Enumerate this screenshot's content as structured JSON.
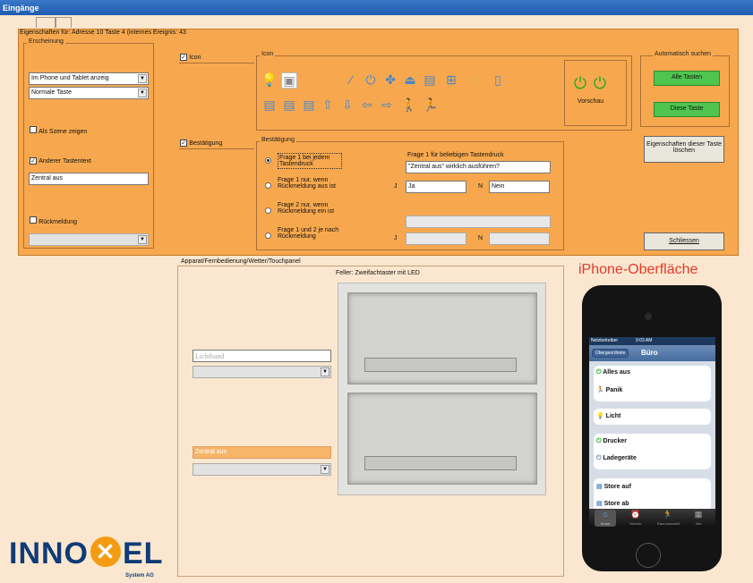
{
  "window": {
    "title": "Eingänge"
  },
  "tabs": [
    "",
    ""
  ],
  "header": {
    "caption": "Eigenschaften für: Adresse 10 Taste 4 (internes Ereignis: 43"
  },
  "erscheinung": {
    "label": "Erscheinung",
    "mode": "Im Phone und Tablet anzeig",
    "type": "Normale Taste",
    "scene_label": "Als Szene zeigen",
    "other_text_label": "Anderer Tastentext",
    "other_text_value": "Zentral aus",
    "feedback_label": "Rückmeldung",
    "feedback_value": ""
  },
  "icon_section": {
    "checkbox_label": "Icon",
    "group_label": "Icon",
    "preview_label": "Vorschau",
    "icons": [
      "bulb-icon",
      "dimmer-bulb-icon",
      "ceiling-light-icon",
      "stand-lamp-icon",
      "pencil-icon",
      "power-icon",
      "fan-icon",
      "ceiling-lamp-icon",
      "blind-icon",
      "window-icon",
      "lock-icon",
      "door-icon",
      "shutter-up-icon",
      "shutter-mid-icon",
      "shutter-down-icon",
      "arrow-up-icon",
      "arrow-down-icon",
      "arrow-left-icon",
      "arrow-right-icon",
      "walker-icon",
      "panic-icon"
    ]
  },
  "confirm": {
    "checkbox_label": "Bestätigung",
    "group_label": "Bestätigung",
    "option1": "Frage 1 bei jedem Tastendruck",
    "option2": "Frage 1 nur, wenn Rückmeldung aus ist",
    "option3": "Frage 2 nur, wenn Rückmeldung ein ist",
    "option4": "Frage 1 und 2 je nach Rückmeldung",
    "q1_title": "Frage 1 für beliebigen Tastendruck",
    "q1_text": "\"Zentral aus\" wirklich ausführen?",
    "j_label": "J",
    "j_value": "Ja",
    "n_label": "N",
    "n_value": "Nein",
    "q2_text": "",
    "j2_value": "",
    "n2_value": ""
  },
  "auto_search": {
    "label": "Automatisch suchen",
    "all_keys": "Alle Tasten",
    "this_key": "Diese Taste"
  },
  "clear_button": "Eigenschaften dieser Taste löschen",
  "close_button": "Schliessen",
  "device": {
    "group_label": "Apparat/Fernbedienung/Wetter/Touchpanel",
    "switch_caption": "Feller: Zweifachtaster mit LED",
    "upper_field": "Lichtband",
    "upper_combo": "",
    "lower_field": "Zentral aus",
    "lower_combo": ""
  },
  "iphone": {
    "heading": "iPhone-Oberfläche",
    "status_carrier": "Netzbetreiber",
    "status_time": "9:03 AM",
    "back_button": "Übergeordnete",
    "nav_title": "Büro",
    "items": [
      "Alles aus",
      "Panik",
      "Licht",
      "Drucker",
      "Ladegeräte",
      "Store auf",
      "Store ab"
    ],
    "tabbar": [
      "Home",
      "Wecker",
      "Raumauswahl",
      "Info"
    ]
  },
  "logo": {
    "text_left": "INNO",
    "text_right": "EL",
    "subtitle": "System AG"
  },
  "colors": {
    "accent_orange": "#f7a84e",
    "title_blue": "#2a6bc0",
    "green_button": "#4fc44f",
    "iphone_heading": "#e33a2a"
  }
}
